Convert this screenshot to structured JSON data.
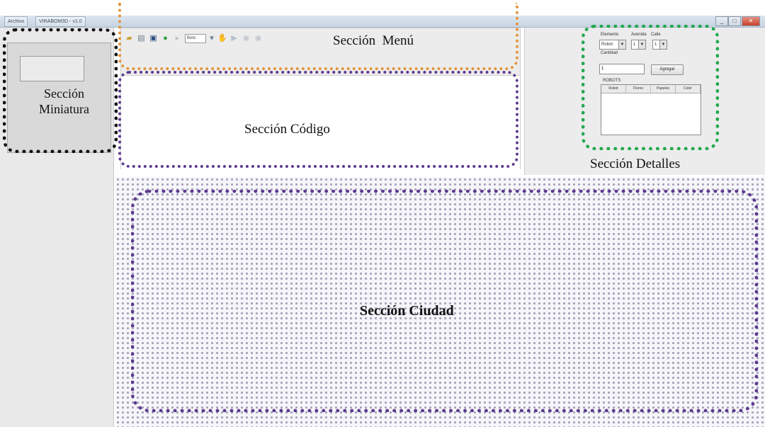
{
  "window": {
    "tabs": [
      "Archivo",
      "VIRABOM3D - v1.0"
    ],
    "buttons": {
      "minimize": "_",
      "maximize": "□",
      "close": "✕"
    }
  },
  "toolbar": {
    "icons": [
      "folder-icon",
      "print-icon",
      "save-icon",
      "check-icon",
      "play-icon",
      "select-icon",
      "hand-icon",
      "step-icon",
      "stop-icon",
      "stop2-icon"
    ],
    "select_value": "Boto"
  },
  "details": {
    "labels": {
      "elemento": "Elemento",
      "avenida": "Avenida",
      "calle": "Calle",
      "cantidad": "Cantidad",
      "robots": "ROBOTS"
    },
    "combos": {
      "elemento": "Robot",
      "avenida": "1",
      "calle": "1"
    },
    "cantidad_value": "1",
    "agregar_button": "Agregar",
    "table_headers": [
      "Robot",
      "Flores",
      "Papeles",
      "Color"
    ]
  },
  "captions": {
    "menu": "Sección  Menú",
    "miniatura_line1": "Sección",
    "miniatura_line2": "Miniatura",
    "codigo": "Sección Código",
    "detalles": "Sección Detalles",
    "ciudad": "Sección Ciudad"
  },
  "colors": {
    "outline_miniatura": "#111111",
    "outline_menu": "#e4973a",
    "outline_codigo": "#5d3a8e",
    "outline_detalles": "#23a84e",
    "outline_ciudad": "#5d3a8e"
  }
}
